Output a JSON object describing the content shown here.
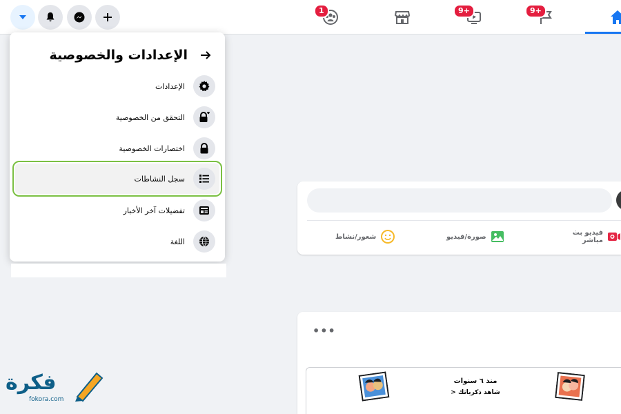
{
  "topbar": {
    "badges": {
      "groups": "1",
      "watch": "9+",
      "pages": "9+"
    },
    "accent": "#1877f2",
    "badge_color": "#e41e3f"
  },
  "menu": {
    "title": "الإعدادات والخصوصية",
    "items": [
      {
        "label": "الإعدادات",
        "icon": "gear-icon"
      },
      {
        "label": "التحقق من الخصوصية",
        "icon": "lock-heart-icon"
      },
      {
        "label": "اختصارات الخصوصية",
        "icon": "lock-icon"
      },
      {
        "label": "سجل النشاطات",
        "icon": "list-icon",
        "highlighted": true
      },
      {
        "label": "تفضيلات آخر الأخبار",
        "icon": "news-feed-icon"
      },
      {
        "label": "اللغة",
        "icon": "globe-icon"
      }
    ],
    "highlight_color": "#7bc043"
  },
  "composer": {
    "actions": [
      {
        "label": "فيديو بث مباشر",
        "icon": "live-video-icon"
      },
      {
        "label": "صورة/فيديو",
        "icon": "photo-icon"
      },
      {
        "label": "شعور/نشاط",
        "icon": "smiley-icon"
      }
    ]
  },
  "memory": {
    "title": "منذ ٦ سنوات",
    "subtitle": "شاهد ذكرياتك"
  },
  "watermark": {
    "text": "فكرة",
    "url": "fokora.com"
  }
}
